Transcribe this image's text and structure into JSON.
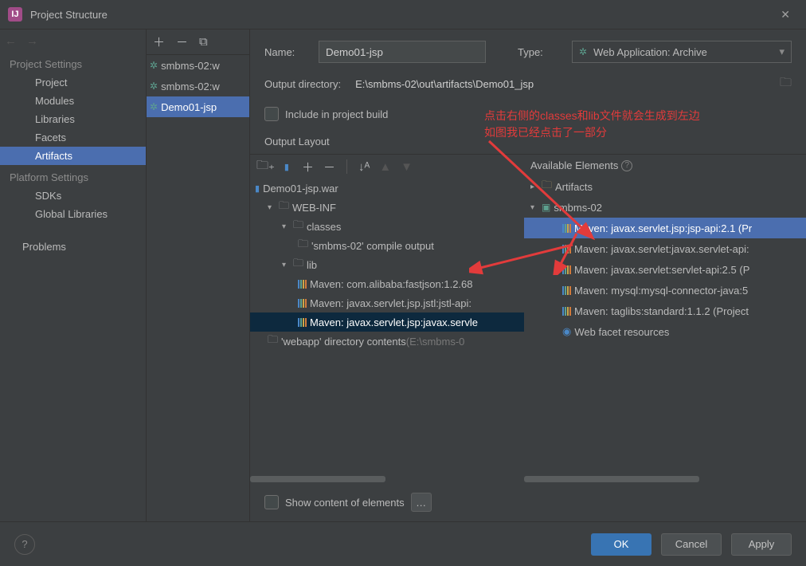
{
  "window": {
    "title": "Project Structure"
  },
  "sidebar": {
    "section1": "Project Settings",
    "items1": [
      "Project",
      "Modules",
      "Libraries",
      "Facets",
      "Artifacts"
    ],
    "selected1": 4,
    "section2": "Platform Settings",
    "items2": [
      "SDKs",
      "Global Libraries"
    ],
    "section3": "Problems"
  },
  "artifact_list": [
    {
      "label": "smbms-02:w"
    },
    {
      "label": "smbms-02:w"
    },
    {
      "label": "Demo01-jsp"
    }
  ],
  "artifact_list_selected": 2,
  "form": {
    "name_label": "Name:",
    "name_value": "Demo01-jsp",
    "type_label": "Type:",
    "type_value": "Web Application: Archive",
    "output_label": "Output directory:",
    "output_path": "E:\\smbms-02\\out\\artifacts\\Demo01_jsp",
    "include_build": "Include in project build",
    "output_layout": "Output Layout",
    "available_elements": "Available Elements",
    "show_content": "Show content of elements"
  },
  "output_tree": {
    "root": "Demo01-jsp.war",
    "webinf": "WEB-INF",
    "classes": "classes",
    "compile_output": "'smbms-02' compile output",
    "lib": "lib",
    "libs": [
      "Maven: com.alibaba:fastjson:1.2.68",
      "Maven: javax.servlet.jsp.jstl:jstl-api:",
      "Maven: javax.servlet.jsp:javax.servle"
    ],
    "webapp_dir": "'webapp' directory contents",
    "webapp_dir_suffix": " (E:\\smbms-0"
  },
  "available_tree": {
    "artifacts": "Artifacts",
    "module": "smbms-02",
    "libs": [
      "Maven: javax.servlet.jsp:jsp-api:2.1 (Pr",
      "Maven: javax.servlet:javax.servlet-api:",
      "Maven: javax.servlet:servlet-api:2.5 (P",
      "Maven: mysql:mysql-connector-java:5",
      "Maven: taglibs:standard:1.1.2 (Project"
    ],
    "web_facet": "Web facet resources"
  },
  "annotation": {
    "line1": "点击右侧的classes和lib文件就会生成到左边",
    "line2": "如图我已经点击了一部分"
  },
  "buttons": {
    "ok": "OK",
    "cancel": "Cancel",
    "apply": "Apply"
  }
}
